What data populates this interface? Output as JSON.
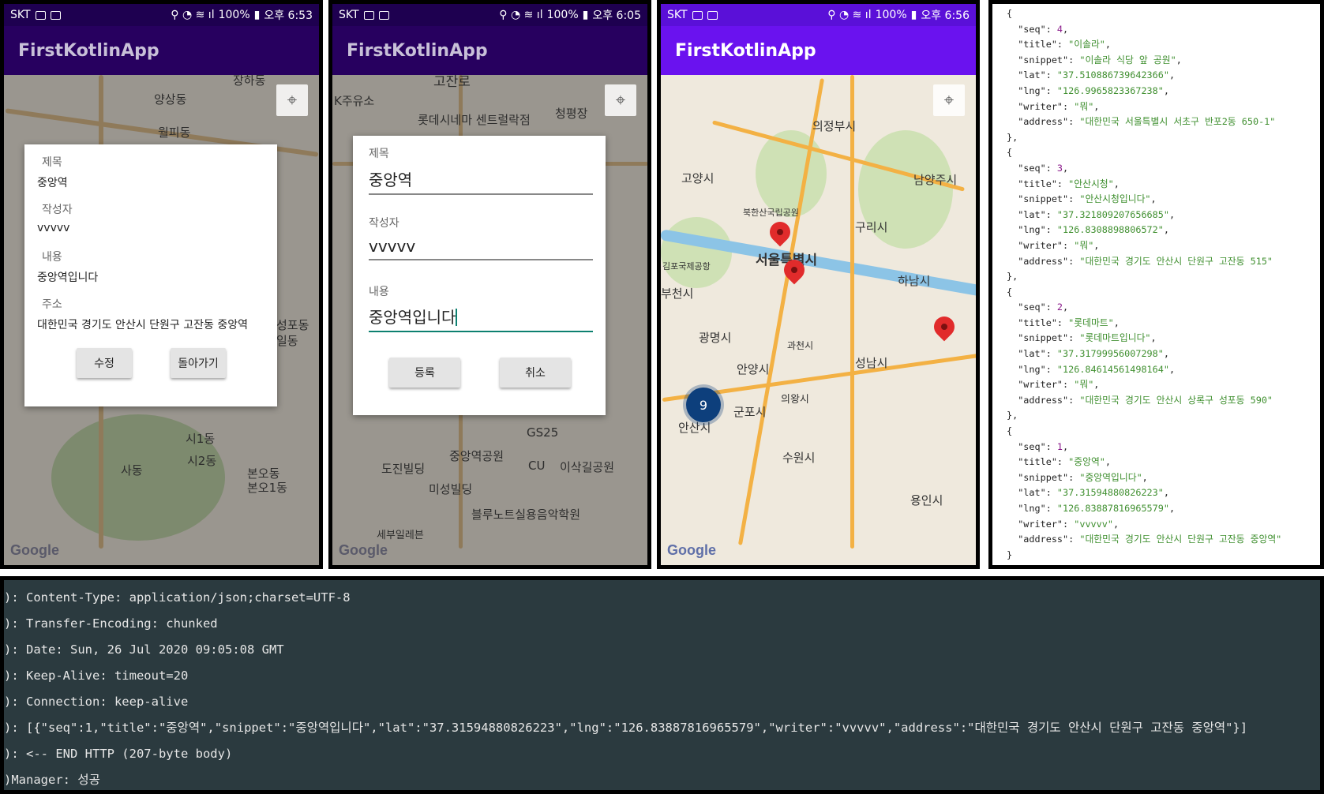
{
  "phones": [
    {
      "status": {
        "carrier": "SKT",
        "battery": "100%",
        "time": "오후 6:53"
      },
      "app_title": "FirstKotlinApp",
      "map_labels": [
        "양상동",
        "월피동",
        "장하동",
        "사동",
        "본오동",
        "본오1동",
        "시1동",
        "시2동",
        "성포동",
        "일동"
      ],
      "dialog": {
        "fields": [
          {
            "label": "제목",
            "value": "중앙역"
          },
          {
            "label": "작성자",
            "value": "vvvvv"
          },
          {
            "label": "내용",
            "value": "중앙역입니다"
          },
          {
            "label": "주소",
            "value": "대한민국 경기도 안산시 단원구 고잔동 중앙역"
          }
        ],
        "buttons": [
          "수정",
          "돌아가기"
        ]
      }
    },
    {
      "status": {
        "carrier": "SKT",
        "battery": "100%",
        "time": "오후 6:05"
      },
      "app_title": "FirstKotlinApp",
      "map_labels": [
        "고잔로",
        "K주유소",
        "롯데시네마 센트럴락점",
        "청평장",
        "GS25",
        "중앙역공원",
        "CU",
        "이삭길공원",
        "도진빌딩",
        "미성빌딩",
        "블루노트실용음악학원",
        "세부일레븐"
      ],
      "dialog": {
        "fields": [
          {
            "label": "제목",
            "value": "중앙역"
          },
          {
            "label": "작성자",
            "value": "vvvvv"
          },
          {
            "label": "내용",
            "value": "중앙역입니다"
          }
        ],
        "buttons": [
          "등록",
          "취소"
        ]
      }
    },
    {
      "status": {
        "carrier": "SKT",
        "battery": "100%",
        "time": "오후 6:56"
      },
      "app_title": "FirstKotlinApp",
      "map_labels": [
        "의정부시",
        "고양시",
        "남양주시",
        "북한산국립공원",
        "구리시",
        "서울특별시",
        "하남시",
        "김포국제공항",
        "부천시",
        "광명시",
        "과천시",
        "성남시",
        "안양시",
        "의왕시",
        "군포시",
        "안산시",
        "수원시",
        "용인시"
      ],
      "cluster_count": "9"
    }
  ],
  "google_logo": "Google",
  "json_records": [
    {
      "seq": 4,
      "title": "이솔라",
      "snippet": "이솔라 식당 앞 공원",
      "lat": "37.510886739642366",
      "lng": "126.9965823367238",
      "writer": "뭐",
      "address": "대한민국 서울특별시 서초구 반포2동 650-1"
    },
    {
      "seq": 3,
      "title": "안산시청",
      "snippet": "안산시청입니다",
      "lat": "37.321809207656685",
      "lng": "126.8308898806572",
      "writer": "뭐",
      "address": "대한민국 경기도 안산시 단원구 고잔동 515"
    },
    {
      "seq": 2,
      "title": "롯데마트",
      "snippet": "롯데마트입니다",
      "lat": "37.31799956007298",
      "lng": "126.84614561498164",
      "writer": "뭐",
      "address": "대한민국 경기도 안산시 상록구 성포동 590"
    },
    {
      "seq": 1,
      "title": "중앙역",
      "snippet": "중앙역입니다",
      "lat": "37.31594880826223",
      "lng": "126.83887816965579",
      "writer": "vvvvv",
      "address": "대한민국 경기도 안산시 단원구 고잔동 중앙역"
    }
  ],
  "log_lines": [
    "): Content-Type: application/json;charset=UTF-8",
    "): Transfer-Encoding: chunked",
    "): Date: Sun, 26 Jul 2020 09:05:08 GMT",
    "): Keep-Alive: timeout=20",
    "): Connection: keep-alive",
    "): [{\"seq\":1,\"title\":\"중앙역\",\"snippet\":\"중앙역입니다\",\"lat\":\"37.31594880826223\",\"lng\":\"126.83887816965579\",\"writer\":\"vvvvv\",\"address\":\"대한민국 경기도 안산시 단원구 고잔동 중앙역\"}]",
    "): <-- END HTTP (207-byte body)",
    ")Manager: 성공"
  ]
}
